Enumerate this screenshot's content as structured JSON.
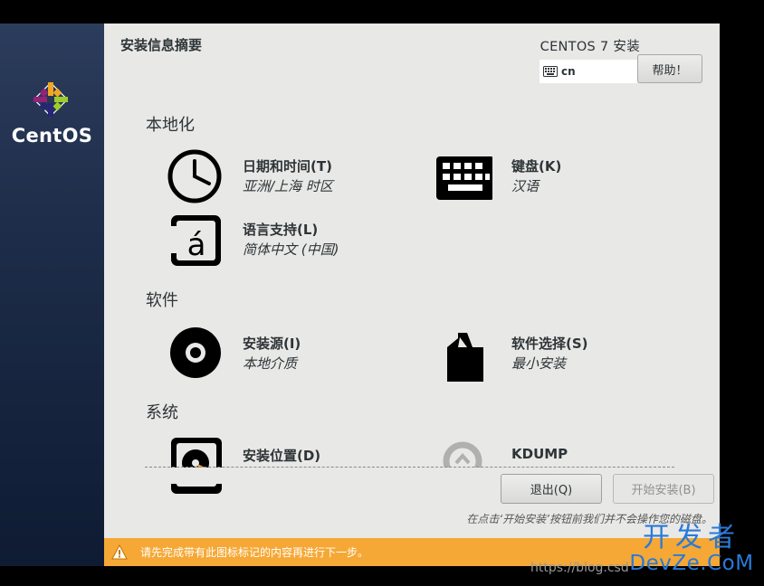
{
  "sidebar": {
    "brand": "CentOS"
  },
  "header": {
    "page_title": "安装信息摘要",
    "installer_title": "CENTOS 7 安装",
    "keyboard_layout": "cn",
    "help_label": "帮助！"
  },
  "sections": {
    "localization": "本地化",
    "software": "软件",
    "system": "系统"
  },
  "spokes": {
    "datetime": {
      "name": "日期和时间(T)",
      "status": "亚洲/上海 时区",
      "icon": "clock-icon"
    },
    "keyboard": {
      "name": "键盘(K)",
      "status": "汉语",
      "icon": "keyboard-icon"
    },
    "language": {
      "name": "语言支持(L)",
      "status": "简体中文 (中国)",
      "icon": "language-icon",
      "glyph": "á"
    },
    "source": {
      "name": "安装源(I)",
      "status": "本地介质",
      "icon": "disc-icon"
    },
    "software_selection": {
      "name": "软件选择(S)",
      "status": "最小安装",
      "icon": "package-icon"
    },
    "destination": {
      "name": "安装位置(D)",
      "icon": "harddisk-icon"
    },
    "kdump": {
      "name": "KDUMP",
      "icon": "kdump-icon"
    }
  },
  "footer": {
    "quit_label": "退出(Q)",
    "begin_label": "开始安装(B)",
    "note": "在点击‘开始安装’按钮前我们并不会操作您的磁盘。"
  },
  "warning": {
    "text": "请先完成带有此图标标记的内容再进行下一步。",
    "color": "#f5a835"
  },
  "watermark": {
    "url": "https://blog.csd",
    "brand_zh": "开发者",
    "brand_en": "DevZe.CoM"
  }
}
